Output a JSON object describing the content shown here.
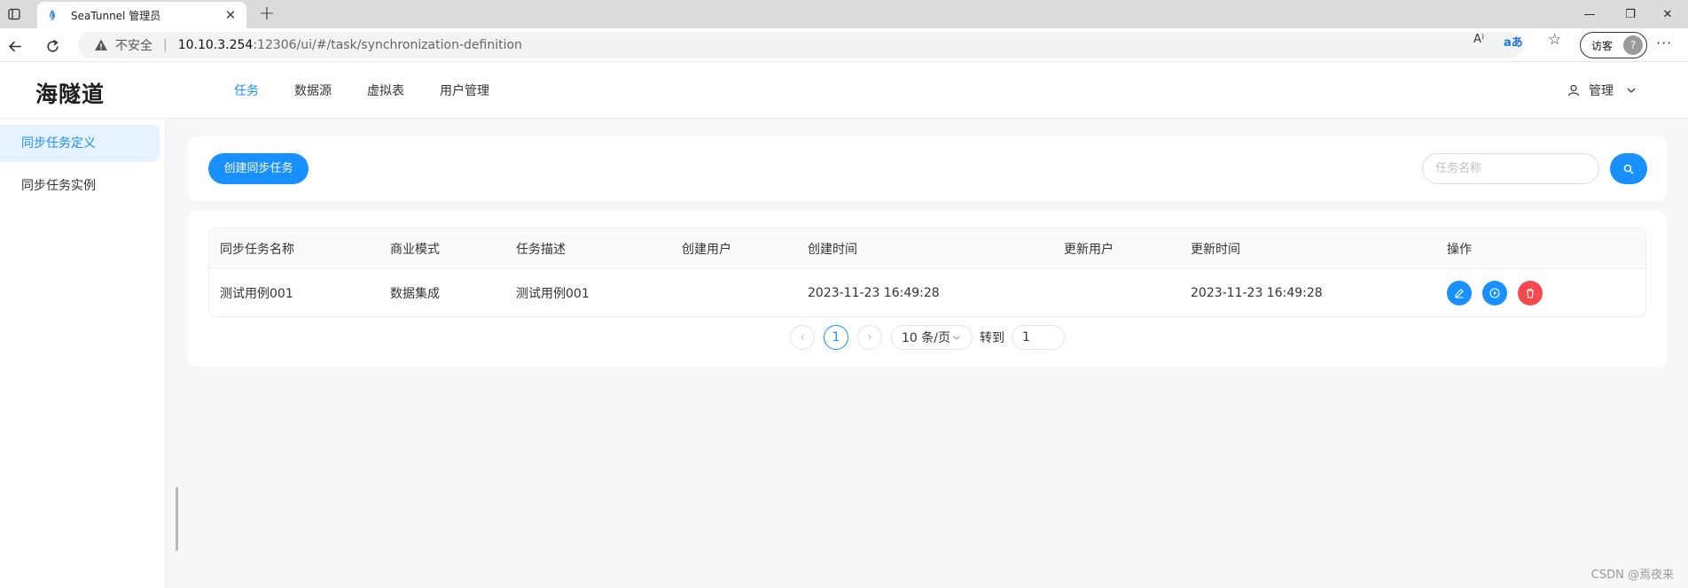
{
  "browser": {
    "tab_title": "SeaTunnel 管理员",
    "tab_close": "✕",
    "new_tab": "+",
    "insecure_label": "不安全",
    "url_separator": "|",
    "url_host": "10.10.3.254",
    "url_path": ":12306/ui/#/task/synchronization-definition",
    "visitor_label": "访客",
    "window_controls": {
      "minimize": "—",
      "restore": "❐",
      "close": "✕"
    },
    "more": "···",
    "read_aloud": "A⁾",
    "translate": "aあ",
    "favorites": "☆"
  },
  "header": {
    "logo": "海隧道",
    "nav": [
      {
        "label": "任务",
        "active": true
      },
      {
        "label": "数据源",
        "active": false
      },
      {
        "label": "虚拟表",
        "active": false
      },
      {
        "label": "用户管理",
        "active": false
      }
    ],
    "user_label": "管理"
  },
  "sidebar": {
    "items": [
      {
        "label": "同步任务定义",
        "active": true
      },
      {
        "label": "同步任务实例",
        "active": false
      }
    ]
  },
  "toolbar": {
    "create_button": "创建同步任务",
    "search_placeholder": "任务名称",
    "search_value": ""
  },
  "table": {
    "columns": [
      "同步任务名称",
      "商业模式",
      "任务描述",
      "创建用户",
      "创建时间",
      "更新用户",
      "更新时间",
      "操作"
    ],
    "rows": [
      {
        "name": "测试用例001",
        "business_model": "数据集成",
        "description": "测试用例001",
        "create_user": "",
        "create_time": "2023-11-23 16:49:28",
        "update_user": "",
        "update_time": "2023-11-23 16:49:28"
      }
    ]
  },
  "pagination": {
    "prev": "‹",
    "next": "›",
    "current_page": "1",
    "page_size": "10 条/页",
    "goto_label": "转到",
    "goto_value": "1"
  },
  "watermark": "CSDN @焉夜来",
  "colors": {
    "primary": "#1890ff",
    "danger": "#f5494d",
    "sidebar_active_bg": "#e6f2ff",
    "page_bg": "#f5f7f9"
  },
  "icons": [
    "sidebar-toggle-icon",
    "favicon",
    "back-icon",
    "refresh-icon",
    "warning-icon",
    "user-icon",
    "chevron-down-icon",
    "search-icon",
    "edit-icon",
    "play-icon",
    "delete-icon"
  ]
}
